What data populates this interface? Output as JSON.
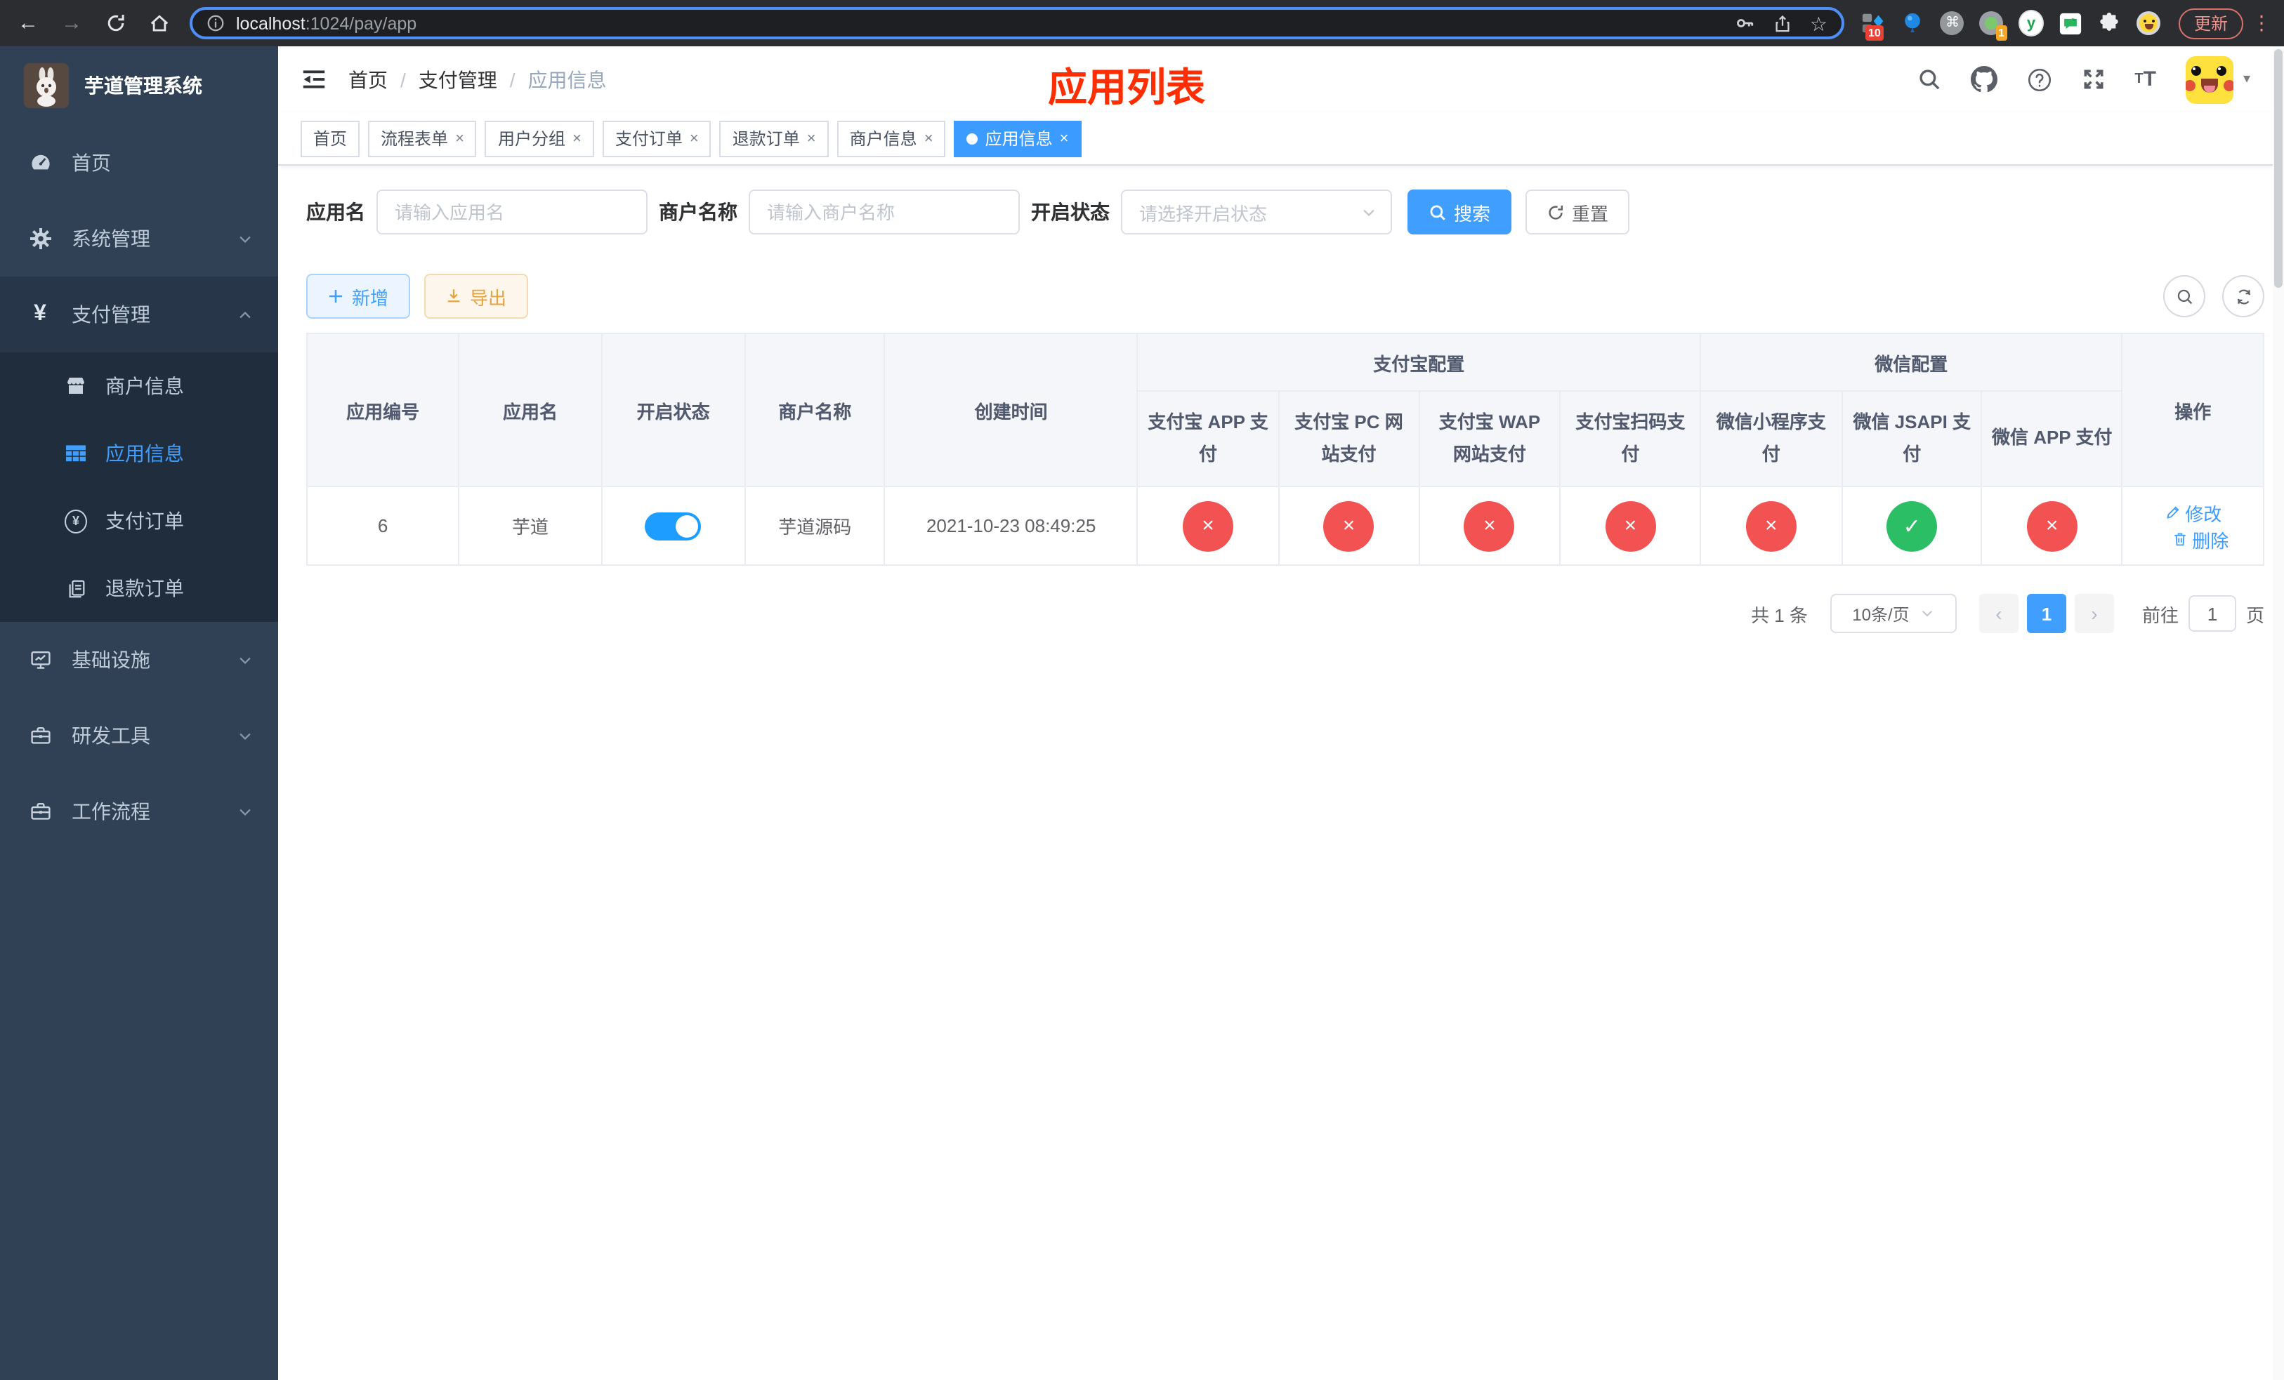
{
  "browser": {
    "url": {
      "host": "localhost",
      "rest": ":1024/pay/app"
    },
    "update_label": "更新",
    "ext_badge_a": "10",
    "ext_badge_b": "1",
    "ext_y_label": "y"
  },
  "sidebar": {
    "app_title": "芋道管理系统",
    "menu": {
      "home": "首页",
      "system": "系统管理",
      "payment": "支付管理",
      "infra": "基础设施",
      "devtools": "研发工具",
      "workflow": "工作流程"
    },
    "submenu": {
      "merchant": "商户信息",
      "app": "应用信息",
      "pay_order": "支付订单",
      "refund_order": "退款订单"
    }
  },
  "header": {
    "breadcrumb": {
      "home": "首页",
      "payment": "支付管理",
      "current": "应用信息"
    },
    "overlay_title": "应用列表"
  },
  "tabs": [
    {
      "label": "首页"
    },
    {
      "label": "流程表单"
    },
    {
      "label": "用户分组"
    },
    {
      "label": "支付订单"
    },
    {
      "label": "退款订单"
    },
    {
      "label": "商户信息"
    },
    {
      "label": "应用信息"
    }
  ],
  "filters": {
    "app_name_label": "应用名",
    "app_name_placeholder": "请输入应用名",
    "merchant_label": "商户名称",
    "merchant_placeholder": "请输入商户名称",
    "status_label": "开启状态",
    "status_placeholder": "请选择开启状态",
    "search_label": "搜索",
    "reset_label": "重置"
  },
  "toolbar": {
    "add_label": "新增",
    "export_label": "导出"
  },
  "table": {
    "headers": {
      "id": "应用编号",
      "name": "应用名",
      "status": "开启状态",
      "merchant": "商户名称",
      "created": "创建时间",
      "alipay_group": "支付宝配置",
      "wechat_group": "微信配置",
      "actions": "操作"
    },
    "sub_headers": [
      "支付宝 APP 支付",
      "支付宝 PC 网站支付",
      "支付宝 WAP 网站支付",
      "支付宝扫码支付",
      "微信小程序支付",
      "微信 JSAPI 支付",
      "微信 APP 支付"
    ],
    "rows": [
      {
        "id": "6",
        "name": "芋道",
        "enabled": true,
        "merchant": "芋道源码",
        "created": "2021-10-23 08:49:25",
        "channel_status": [
          false,
          false,
          false,
          false,
          false,
          true,
          false
        ],
        "edit_label": "修改",
        "delete_label": "删除"
      }
    ]
  },
  "pagination": {
    "total": "共 1 条",
    "page_size": "10条/页",
    "current_page": "1",
    "goto_label": "前往",
    "page_unit": "页",
    "goto_value": "1"
  },
  "colors": {
    "accent": "#409eff",
    "danger": "#f35252",
    "success": "#2cbe64",
    "title_red": "#ff2d00",
    "sidebar_bg": "#304156",
    "submenu_bg": "#1f2d3d"
  }
}
